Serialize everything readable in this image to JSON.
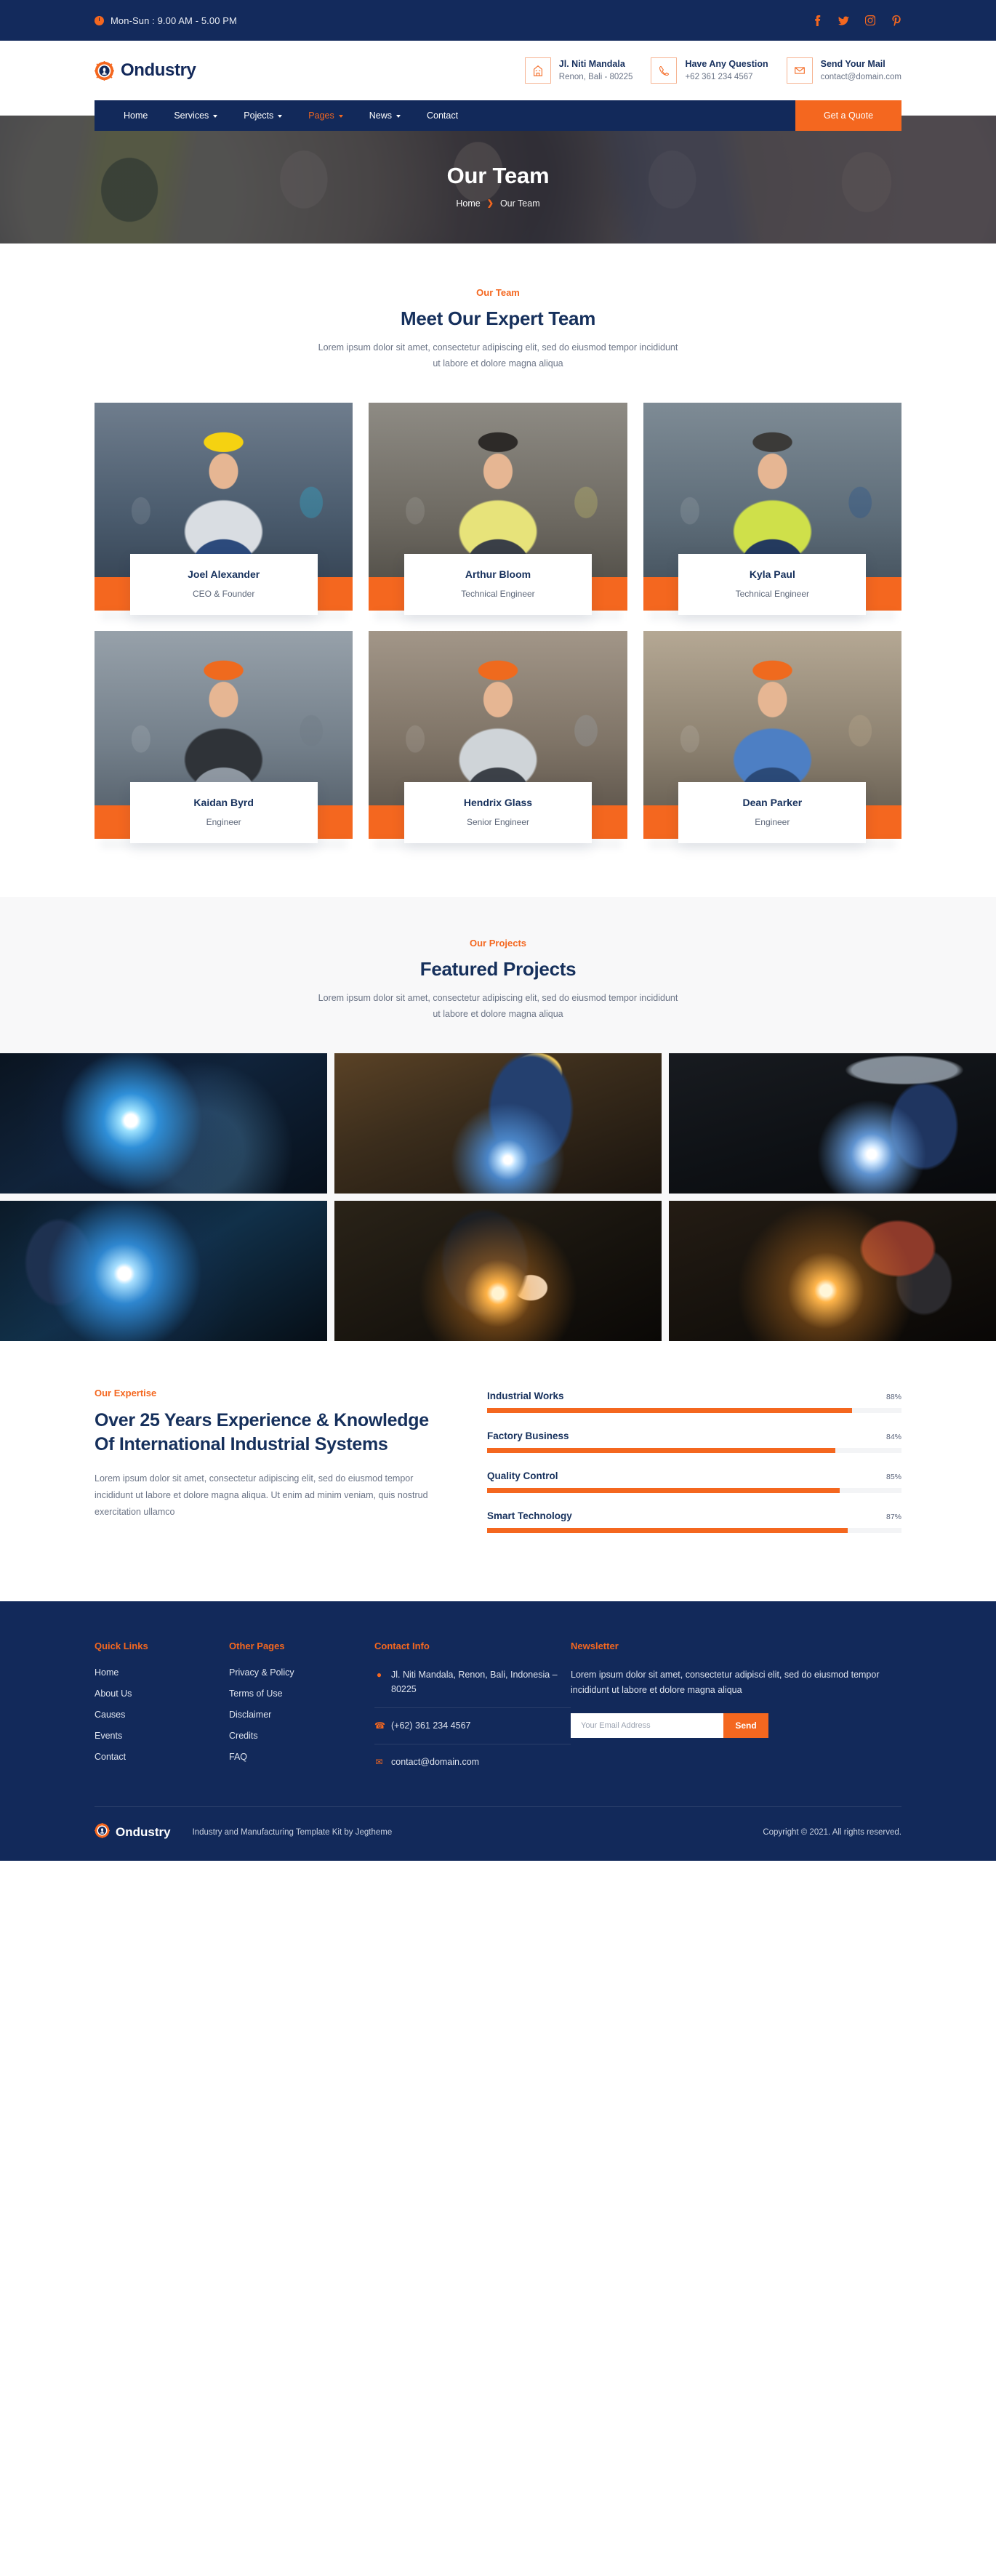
{
  "topbar": {
    "hours": "Mon-Sun : 9.00 AM - 5.00 PM",
    "socials": [
      {
        "name": "facebook-icon",
        "label": "Facebook"
      },
      {
        "name": "twitter-icon",
        "label": "Twitter"
      },
      {
        "name": "instagram-icon",
        "label": "Instagram"
      },
      {
        "name": "pinterest-icon",
        "label": "Pinterest"
      }
    ]
  },
  "header": {
    "brand": "Ondustry",
    "contacts": [
      {
        "icon": "building-icon",
        "title": "Jl. Niti Mandala",
        "sub": "Renon, Bali - 80225"
      },
      {
        "icon": "phone-icon",
        "title": "Have Any Question",
        "sub": "+62 361 234 4567"
      },
      {
        "icon": "envelope-icon",
        "title": "Send Your Mail",
        "sub": "contact@domain.com"
      }
    ]
  },
  "nav": {
    "items": [
      {
        "label": "Home",
        "has_dropdown": false,
        "active": false
      },
      {
        "label": "Services",
        "has_dropdown": true,
        "active": false
      },
      {
        "label": "Pojects",
        "has_dropdown": true,
        "active": false
      },
      {
        "label": "Pages",
        "has_dropdown": true,
        "active": true
      },
      {
        "label": "News",
        "has_dropdown": true,
        "active": false
      },
      {
        "label": "Contact",
        "has_dropdown": false,
        "active": false
      }
    ],
    "cta": "Get a Quote"
  },
  "hero": {
    "title": "Our Team",
    "breadcrumb": [
      "Home",
      "Our Team"
    ]
  },
  "team_section": {
    "eyebrow": "Our Team",
    "title": "Meet Our Expert Team",
    "description": "Lorem ipsum dolor sit amet, consectetur adipiscing elit, sed do eiusmod tempor incididunt ut labore et dolore magna aliqua",
    "members": [
      {
        "name": "Joel Alexander",
        "role": "CEO & Founder"
      },
      {
        "name": "Arthur Bloom",
        "role": "Technical Engineer"
      },
      {
        "name": "Kyla Paul",
        "role": "Technical Engineer"
      },
      {
        "name": "Kaidan Byrd",
        "role": "Engineer"
      },
      {
        "name": "Hendrix Glass",
        "role": "Senior Engineer"
      },
      {
        "name": "Dean Parker",
        "role": "Engineer"
      }
    ]
  },
  "projects_section": {
    "eyebrow": "Our Projects",
    "title": "Featured Projects",
    "description": "Lorem ipsum dolor sit amet, consectetur adipiscing elit, sed do eiusmod tempor incididunt ut labore et dolore magna aliqua",
    "items": [
      {
        "name": "welding-sparks-blue"
      },
      {
        "name": "welder-beam-workshop"
      },
      {
        "name": "grinding-sparks-factory"
      },
      {
        "name": "welding-plate-blue-arc"
      },
      {
        "name": "welder-mask-orange-sparks"
      },
      {
        "name": "angle-grinder-sparks"
      }
    ]
  },
  "expertise": {
    "eyebrow": "Our Expertise",
    "title": "Over 25 Years Experience & Knowledge Of International Industrial Systems",
    "text": "Lorem ipsum dolor sit amet, consectetur adipiscing elit, sed do eiusmod tempor incididunt ut labore et dolore magna aliqua. Ut enim ad minim veniam, quis nostrud exercitation ullamco"
  },
  "chart_data": {
    "type": "bar",
    "title": "Our Expertise",
    "categories": [
      "Industrial Works",
      "Factory Business",
      "Quality Control",
      "Smart Technology"
    ],
    "values": [
      88,
      84,
      85,
      87
    ],
    "value_labels": [
      "88%",
      "84%",
      "85%",
      "87%"
    ],
    "xlabel": "",
    "ylabel": "",
    "ylim": [
      0,
      100
    ],
    "orientation": "horizontal",
    "bar_color": "#f4671f",
    "track_color": "#f3f4f6",
    "grid": false,
    "legend": "none"
  },
  "footer": {
    "columns": [
      {
        "heading": "Quick Links",
        "links": [
          "Home",
          "About Us",
          "Causes",
          "Events",
          "Contact"
        ]
      },
      {
        "heading": "Other Pages",
        "links": [
          "Privacy & Policy",
          "Terms of Use",
          "Disclaimer",
          "Credits",
          "FAQ"
        ]
      }
    ],
    "contact": {
      "heading": "Contact Info",
      "address": "Jl. Niti Mandala, Renon, Bali, Indonesia – 80225",
      "phone": "(+62) 361 234 4567",
      "email": "contact@domain.com"
    },
    "newsletter": {
      "heading": "Newsletter",
      "text": "Lorem ipsum dolor sit amet, consectetur adipisci elit, sed do eiusmod tempor incididunt ut labore et dolore magna aliqua",
      "placeholder": "Your Email Address",
      "value": "",
      "button": "Send"
    },
    "bottom": {
      "brand": "Ondustry",
      "tagline": "Industry and Manufacturing Template Kit by Jegtheme",
      "copyright": "Copyright © 2021. All rights reserved."
    }
  },
  "colors": {
    "navy": "#12295a",
    "orange": "#f4671f",
    "muted": "#6b7486",
    "light_bg": "#f8f8f9"
  }
}
